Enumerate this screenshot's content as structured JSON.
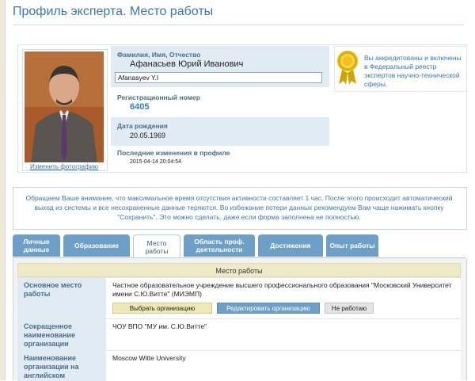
{
  "page": {
    "title": "Профиль эксперта. Место работы"
  },
  "profile": {
    "photo_link": "Изменить фотографию",
    "name_label": "Фамилия, Имя, Отчество",
    "name_value": "Афанасьев Юрий Иванович",
    "name_latin": "Afanasyev Y.I",
    "reg_label": "Регистрационный номер",
    "reg_value": "6405",
    "birth_label": "Дата рождения",
    "birth_value": "20.05.1969",
    "changes_label": "Последние изменения в профиле",
    "changes_value": "2015-04-14 20:04:54"
  },
  "accreditation": {
    "text": "Вы аккредитованы и включены в Федеральный реестр экспертов научно-технической сферы.",
    "icon": "award-medal-icon"
  },
  "notice": {
    "text": "Обращаем Ваше внимание, что максимальное время отсутствия активности составляет 1 час. После этого происходит автоматический выход из системы и все несохраненные данные теряются. Во избежание потери данных рекомендуем Вам чаще нажимать кнопку \"Сохранить\". Это можно сделать, даже если форма заполнена не полностью."
  },
  "tabs": [
    {
      "label": "Личные данные"
    },
    {
      "label": "Образование"
    },
    {
      "label": "Место работы"
    },
    {
      "label": "Область проф. деятельности"
    },
    {
      "label": "Достижения"
    },
    {
      "label": "Опыт работы"
    }
  ],
  "section": {
    "title": "Место работы",
    "rows": [
      {
        "label": "Основное место работы",
        "value": "Частное образовательное учреждение высшего профессионального образования \"Московский Университет имени С.Ю.Витте\" (МИЭМП)"
      },
      {
        "label": "Сокращенное наименование организации",
        "value": "ЧОУ ВПО \"МУ им. С.Ю.Витте\""
      },
      {
        "label": "Наименование организации на английском",
        "value": "Moscow Witte University"
      }
    ],
    "buttons": {
      "select": "Выбрать организацию",
      "edit": "Редактировать организацию",
      "not_working": "Не работаю"
    }
  },
  "colors": {
    "accent": "#3a77b8",
    "tab": "#6e9fc7",
    "label_band": "#e1ebf3",
    "section_head": "#eee9c8"
  }
}
